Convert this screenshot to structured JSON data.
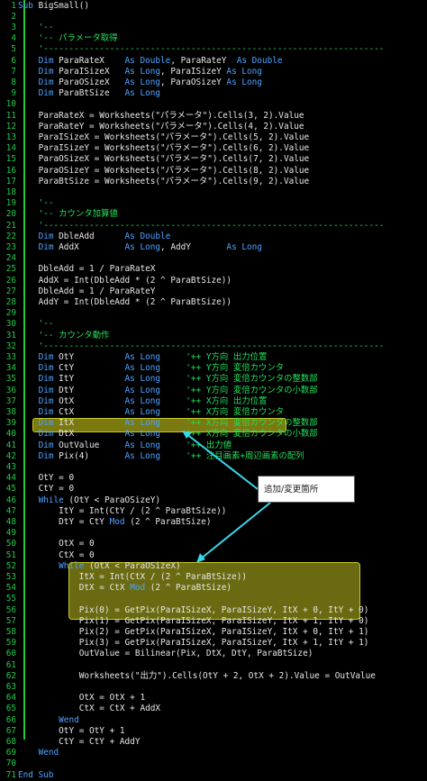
{
  "callout": {
    "text": "追加/変更箇所"
  },
  "lines": [
    {
      "n": "1",
      "s": [
        [
          "k",
          "Sub "
        ],
        [
          "t",
          "BigSmall()"
        ]
      ]
    },
    {
      "n": "2",
      "s": []
    },
    {
      "n": "3",
      "s": [
        [
          "c",
          "    '--"
        ]
      ]
    },
    {
      "n": "4",
      "s": [
        [
          "c",
          "    '-- パラメータ取得"
        ]
      ]
    },
    {
      "n": "5",
      "s": [
        [
          "c",
          "    '-------------------------------------------------------------------"
        ]
      ]
    },
    {
      "n": "6",
      "s": [
        [
          "k",
          "    Dim "
        ],
        [
          "t",
          "ParaRateX    "
        ],
        [
          "k",
          "As Double"
        ],
        [
          "t",
          ", ParaRateY  "
        ],
        [
          "k",
          "As Double"
        ]
      ]
    },
    {
      "n": "7",
      "s": [
        [
          "k",
          "    Dim "
        ],
        [
          "t",
          "ParaISizeX   "
        ],
        [
          "k",
          "As Long"
        ],
        [
          "t",
          ", ParaISizeY "
        ],
        [
          "k",
          "As Long"
        ]
      ]
    },
    {
      "n": "8",
      "s": [
        [
          "k",
          "    Dim "
        ],
        [
          "t",
          "ParaOSizeX   "
        ],
        [
          "k",
          "As Long"
        ],
        [
          "t",
          ", ParaOSizeY "
        ],
        [
          "k",
          "As Long"
        ]
      ]
    },
    {
      "n": "9",
      "s": [
        [
          "k",
          "    Dim "
        ],
        [
          "t",
          "ParaBtSize   "
        ],
        [
          "k",
          "As Long"
        ]
      ]
    },
    {
      "n": "10",
      "s": []
    },
    {
      "n": "11",
      "s": [
        [
          "t",
          "    ParaRateX = Worksheets(\"パラメータ\").Cells(3, 2).Value"
        ]
      ]
    },
    {
      "n": "12",
      "s": [
        [
          "t",
          "    ParaRateY = Worksheets(\"パラメータ\").Cells(4, 2).Value"
        ]
      ]
    },
    {
      "n": "13",
      "s": [
        [
          "t",
          "    ParaISizeX = Worksheets(\"パラメータ\").Cells(5, 2).Value"
        ]
      ]
    },
    {
      "n": "14",
      "s": [
        [
          "t",
          "    ParaISizeY = Worksheets(\"パラメータ\").Cells(6, 2).Value"
        ]
      ]
    },
    {
      "n": "15",
      "s": [
        [
          "t",
          "    ParaOSizeX = Worksheets(\"パラメータ\").Cells(7, 2).Value"
        ]
      ]
    },
    {
      "n": "16",
      "s": [
        [
          "t",
          "    ParaOSizeY = Worksheets(\"パラメータ\").Cells(8, 2).Value"
        ]
      ]
    },
    {
      "n": "17",
      "s": [
        [
          "t",
          "    ParaBtSize = Worksheets(\"パラメータ\").Cells(9, 2).Value"
        ]
      ]
    },
    {
      "n": "18",
      "s": []
    },
    {
      "n": "19",
      "s": [
        [
          "c",
          "    '--"
        ]
      ]
    },
    {
      "n": "20",
      "s": [
        [
          "c",
          "    '-- カウンタ加算値"
        ]
      ]
    },
    {
      "n": "21",
      "s": [
        [
          "c",
          "    '-------------------------------------------------------------------"
        ]
      ]
    },
    {
      "n": "22",
      "s": [
        [
          "k",
          "    Dim "
        ],
        [
          "t",
          "DbleAdd      "
        ],
        [
          "k",
          "As Double"
        ]
      ]
    },
    {
      "n": "23",
      "s": [
        [
          "k",
          "    Dim "
        ],
        [
          "t",
          "AddX         "
        ],
        [
          "k",
          "As Long"
        ],
        [
          "t",
          ", AddY       "
        ],
        [
          "k",
          "As Long"
        ]
      ]
    },
    {
      "n": "24",
      "s": []
    },
    {
      "n": "25",
      "s": [
        [
          "t",
          "    DbleAdd = 1 / ParaRateX"
        ]
      ]
    },
    {
      "n": "26",
      "s": [
        [
          "t",
          "    AddX = Int(DbleAdd * (2 ^ ParaBtSize))"
        ]
      ]
    },
    {
      "n": "27",
      "s": [
        [
          "t",
          "    DbleAdd = 1 / ParaRateY"
        ]
      ]
    },
    {
      "n": "28",
      "s": [
        [
          "t",
          "    AddY = Int(DbleAdd * (2 ^ ParaBtSize))"
        ]
      ]
    },
    {
      "n": "29",
      "s": []
    },
    {
      "n": "30",
      "s": [
        [
          "c",
          "    '--"
        ]
      ]
    },
    {
      "n": "31",
      "s": [
        [
          "c",
          "    '-- カウンタ動作"
        ]
      ]
    },
    {
      "n": "32",
      "s": [
        [
          "c",
          "    '-------------------------------------------------------------------"
        ]
      ]
    },
    {
      "n": "33",
      "s": [
        [
          "k",
          "    Dim "
        ],
        [
          "t",
          "OtY          "
        ],
        [
          "k",
          "As Long     "
        ],
        [
          "c",
          "'++ Y方向 出力位置"
        ]
      ]
    },
    {
      "n": "34",
      "s": [
        [
          "k",
          "    Dim "
        ],
        [
          "t",
          "CtY          "
        ],
        [
          "k",
          "As Long     "
        ],
        [
          "c",
          "'++ Y方向 変倍カウンタ"
        ]
      ]
    },
    {
      "n": "35",
      "s": [
        [
          "k",
          "    Dim "
        ],
        [
          "t",
          "ItY          "
        ],
        [
          "k",
          "As Long     "
        ],
        [
          "c",
          "'++ Y方向 変倍カウンタの整数部"
        ]
      ]
    },
    {
      "n": "36",
      "s": [
        [
          "k",
          "    Dim "
        ],
        [
          "t",
          "DtY          "
        ],
        [
          "k",
          "As Long     "
        ],
        [
          "c",
          "'++ Y方向 変倍カウンタの小数部"
        ]
      ]
    },
    {
      "n": "37",
      "s": [
        [
          "k",
          "    Dim "
        ],
        [
          "t",
          "OtX          "
        ],
        [
          "k",
          "As Long     "
        ],
        [
          "c",
          "'++ X方向 出力位置"
        ]
      ]
    },
    {
      "n": "38",
      "s": [
        [
          "k",
          "    Dim "
        ],
        [
          "t",
          "CtX          "
        ],
        [
          "k",
          "As Long     "
        ],
        [
          "c",
          "'++ X方向 変倍カウンタ"
        ]
      ]
    },
    {
      "n": "39",
      "s": [
        [
          "k",
          "    Dim "
        ],
        [
          "t",
          "ItX          "
        ],
        [
          "k",
          "As Long     "
        ],
        [
          "c",
          "'++ X方向 変倍カウンタの整数部"
        ]
      ]
    },
    {
      "n": "40",
      "s": [
        [
          "k",
          "    Dim "
        ],
        [
          "t",
          "DtX          "
        ],
        [
          "k",
          "As Long     "
        ],
        [
          "c",
          "'++ X方向 変倍カウンタの小数部"
        ]
      ]
    },
    {
      "n": "41",
      "s": [
        [
          "k",
          "    Dim "
        ],
        [
          "t",
          "OutValue     "
        ],
        [
          "k",
          "As Long     "
        ],
        [
          "c",
          "'++ 出力値"
        ]
      ]
    },
    {
      "n": "42",
      "s": [
        [
          "k",
          "    Dim "
        ],
        [
          "t",
          "Pix(4)       "
        ],
        [
          "k",
          "As Long     "
        ],
        [
          "c",
          "'++ 注目画素+周辺画素の配列"
        ]
      ]
    },
    {
      "n": "43",
      "s": []
    },
    {
      "n": "44",
      "s": [
        [
          "t",
          "    OtY = 0"
        ]
      ]
    },
    {
      "n": "45",
      "s": [
        [
          "t",
          "    CtY = 0"
        ]
      ]
    },
    {
      "n": "46",
      "s": [
        [
          "k",
          "    While "
        ],
        [
          "t",
          "(OtY < ParaOSizeY)"
        ]
      ]
    },
    {
      "n": "47",
      "s": [
        [
          "t",
          "        ItY = Int(CtY / (2 ^ ParaBtSize))"
        ]
      ]
    },
    {
      "n": "48",
      "s": [
        [
          "t",
          "        DtY = CtY "
        ],
        [
          "k",
          "Mod"
        ],
        [
          "t",
          " (2 ^ ParaBtSize)"
        ]
      ]
    },
    {
      "n": "49",
      "s": []
    },
    {
      "n": "50",
      "s": [
        [
          "t",
          "        OtX = 0"
        ]
      ]
    },
    {
      "n": "51",
      "s": [
        [
          "t",
          "        CtX = 0"
        ]
      ]
    },
    {
      "n": "52",
      "s": [
        [
          "k",
          "        While "
        ],
        [
          "t",
          "(OtX < ParaOSizeX)"
        ]
      ]
    },
    {
      "n": "53",
      "s": [
        [
          "t",
          "            ItX = Int(CtX / (2 ^ ParaBtSize))"
        ]
      ]
    },
    {
      "n": "54",
      "s": [
        [
          "t",
          "            DtX = CtX "
        ],
        [
          "k",
          "Mod"
        ],
        [
          "t",
          " (2 ^ ParaBtSize)"
        ]
      ]
    },
    {
      "n": "55",
      "s": []
    },
    {
      "n": "56",
      "s": [
        [
          "t",
          "            Pix(0) = GetPix(ParaISizeX, ParaISizeY, ItX + 0, ItY + 0)"
        ]
      ]
    },
    {
      "n": "57",
      "s": [
        [
          "t",
          "            Pix(1) = GetPix(ParaISizeX, ParaISizeY, ItX + 1, ItY + 0)"
        ]
      ]
    },
    {
      "n": "58",
      "s": [
        [
          "t",
          "            Pix(2) = GetPix(ParaISizeX, ParaISizeY, ItX + 0, ItY + 1)"
        ]
      ]
    },
    {
      "n": "59",
      "s": [
        [
          "t",
          "            Pix(3) = GetPix(ParaISizeX, ParaISizeY, ItX + 1, ItY + 1)"
        ]
      ]
    },
    {
      "n": "60",
      "s": [
        [
          "t",
          "            OutValue = Bilinear(Pix, DtX, DtY, ParaBtSize)"
        ]
      ]
    },
    {
      "n": "61",
      "s": []
    },
    {
      "n": "62",
      "s": [
        [
          "t",
          "            Worksheets(\"出力\").Cells(OtY + 2, OtX + 2).Value = OutValue"
        ]
      ]
    },
    {
      "n": "63",
      "s": []
    },
    {
      "n": "64",
      "s": [
        [
          "t",
          "            OtX = OtX + 1"
        ]
      ]
    },
    {
      "n": "65",
      "s": [
        [
          "t",
          "            CtX = CtX + AddX"
        ]
      ]
    },
    {
      "n": "66",
      "s": [
        [
          "k",
          "        Wend"
        ]
      ]
    },
    {
      "n": "67",
      "s": [
        [
          "t",
          "        OtY = OtY + 1"
        ]
      ]
    },
    {
      "n": "68",
      "s": [
        [
          "t",
          "        CtY = CtY + AddY"
        ]
      ]
    },
    {
      "n": "69",
      "s": [
        [
          "k",
          "    Wend"
        ]
      ]
    },
    {
      "n": "70",
      "s": []
    },
    {
      "n": "71",
      "s": [
        [
          "k",
          "End Sub"
        ]
      ]
    }
  ]
}
